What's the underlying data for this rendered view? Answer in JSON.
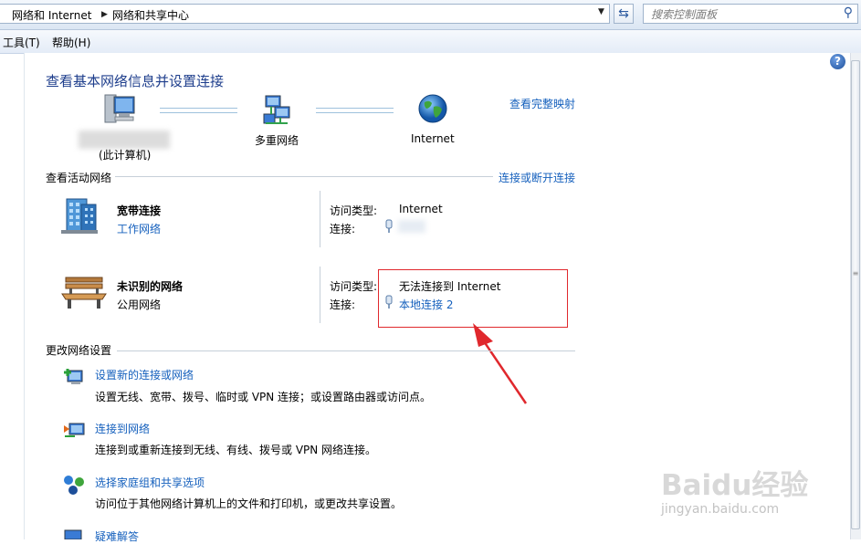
{
  "address": {
    "crumbs": [
      "网络和 Internet",
      "网络和共享中心"
    ],
    "search_placeholder": "搜索控制面板"
  },
  "menu": [
    "工具(T)",
    "帮助(H)"
  ],
  "page": {
    "title": "查看基本网络信息并设置连接",
    "view_full_map": "查看完整映射",
    "map": {
      "computer_label": "(此计算机)",
      "multi_network_label": "多重网络",
      "internet_label": "Internet"
    },
    "active_section": {
      "title": "查看活动网络",
      "action_link": "连接或断开连接",
      "networks": [
        {
          "name": "宽带连接",
          "type": "工作网络",
          "access_label": "访问类型:",
          "access_value": "Internet",
          "conn_label": "连接:",
          "conn_value": ""
        },
        {
          "name": "未识别的网络",
          "type": "公用网络",
          "access_label": "访问类型:",
          "access_value": "无法连接到 Internet",
          "conn_label": "连接:",
          "conn_value": "本地连接 2"
        }
      ]
    },
    "change_section": {
      "title": "更改网络设置",
      "items": [
        {
          "title": "设置新的连接或网络",
          "desc": "设置无线、宽带、拨号、临时或 VPN 连接；或设置路由器或访问点。"
        },
        {
          "title": "连接到网络",
          "desc": "连接到或重新连接到无线、有线、拨号或 VPN 网络连接。"
        },
        {
          "title": "选择家庭组和共享选项",
          "desc": "访问位于其他网络计算机上的文件和打印机，或更改共享设置。"
        },
        {
          "title": "疑难解答",
          "desc": ""
        }
      ]
    }
  },
  "watermark": {
    "brand": "Baidu经验",
    "url": "jingyan.baidu.com"
  },
  "colors": {
    "link": "#1560bd",
    "title": "#1e3e8c",
    "annotation": "#e0282d"
  }
}
